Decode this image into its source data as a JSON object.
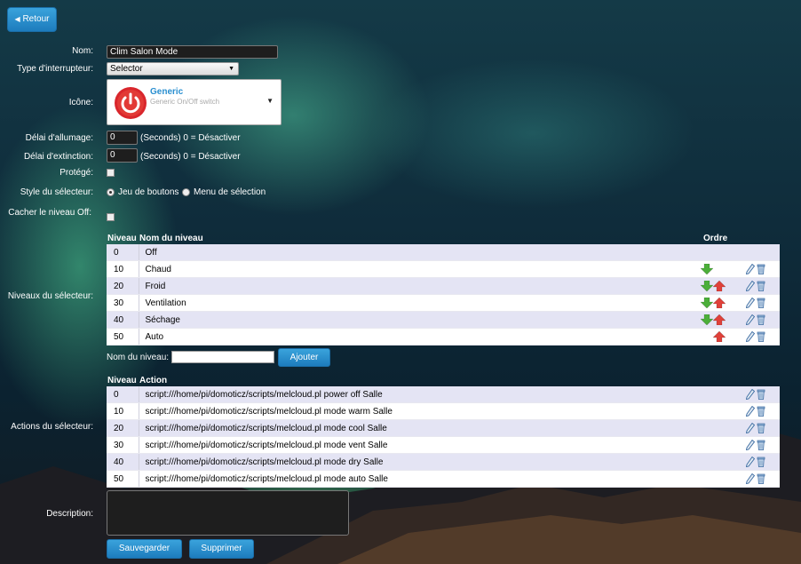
{
  "back_button": "Retour",
  "labels": {
    "name": "Nom:",
    "switch_type": "Type d'interrupteur:",
    "icon": "Icône:",
    "on_delay": "Délai d'allumage:",
    "off_delay": "Délai d'extinction:",
    "protected": "Protégé:",
    "selector_style": "Style du sélecteur:",
    "hide_off": "Cacher le niveau Off:",
    "selector_levels": "Niveaux du sélecteur:",
    "selector_actions": "Actions du sélecteur:",
    "description": "Description:"
  },
  "form": {
    "name_value": "Clim Salon Mode",
    "switch_type_value": "Selector",
    "icon_title": "Generic",
    "icon_subtitle": "Generic On/Off switch",
    "on_delay_value": "0",
    "off_delay_value": "0",
    "delay_hint": "(Seconds) 0 = Désactiver",
    "style_option_buttons": "Jeu de boutons",
    "style_option_menu": "Menu de sélection",
    "level_name_label": "Nom du niveau:",
    "add_button": "Ajouter",
    "description_value": ""
  },
  "levels_table": {
    "col_level": "Niveau",
    "col_name": "Nom du niveau",
    "col_order": "Ordre",
    "rows": [
      {
        "level": "0",
        "name": "Off",
        "down": false,
        "up": false
      },
      {
        "level": "10",
        "name": "Chaud",
        "down": true,
        "up": false
      },
      {
        "level": "20",
        "name": "Froid",
        "down": true,
        "up": true
      },
      {
        "level": "30",
        "name": "Ventilation",
        "down": true,
        "up": true
      },
      {
        "level": "40",
        "name": "Séchage",
        "down": true,
        "up": true
      },
      {
        "level": "50",
        "name": "Auto",
        "down": false,
        "up": true
      }
    ]
  },
  "actions_table": {
    "col_level": "Niveau",
    "col_action": "Action",
    "rows": [
      {
        "level": "0",
        "action": "script:///home/pi/domoticz/scripts/melcloud.pl power off Salle"
      },
      {
        "level": "10",
        "action": "script:///home/pi/domoticz/scripts/melcloud.pl mode warm Salle"
      },
      {
        "level": "20",
        "action": "script:///home/pi/domoticz/scripts/melcloud.pl mode cool Salle"
      },
      {
        "level": "30",
        "action": "script:///home/pi/domoticz/scripts/melcloud.pl mode vent Salle"
      },
      {
        "level": "40",
        "action": "script:///home/pi/domoticz/scripts/melcloud.pl mode dry Salle"
      },
      {
        "level": "50",
        "action": "script:///home/pi/domoticz/scripts/melcloud.pl mode auto Salle"
      }
    ]
  },
  "buttons": {
    "save": "Sauvegarder",
    "delete": "Supprimer"
  },
  "colors": {
    "accent": "#2a8fd0",
    "icon_red": "#d9262c",
    "arrow_green": "#4caf3a",
    "arrow_red": "#e0413a"
  }
}
